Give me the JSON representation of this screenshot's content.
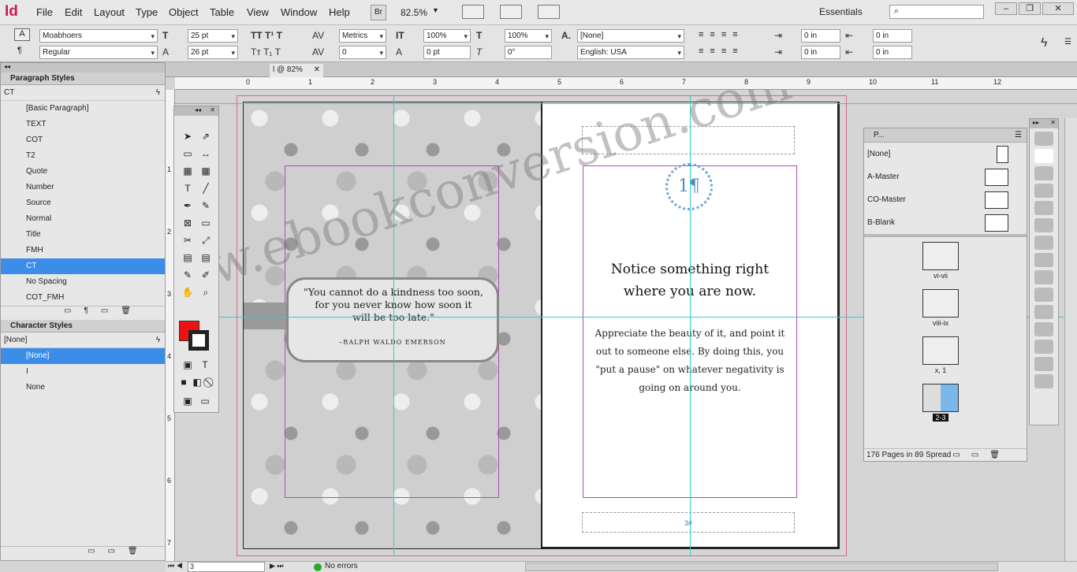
{
  "app": {
    "logo": "Id",
    "menu": [
      "File",
      "Edit",
      "Layout",
      "Type",
      "Object",
      "Table",
      "View",
      "Window",
      "Help"
    ],
    "bridge_btn": "Br",
    "zoom": "82.5%",
    "workspace": "Essentials",
    "search_placeholder": ""
  },
  "control": {
    "font_family": "Moabhoers",
    "font_style": "Regular",
    "font_size": "25 pt",
    "leading": "26 pt",
    "kerning": "Metrics",
    "tracking": "0",
    "vscale": "100%",
    "hscale": "100%",
    "baseline": "0 pt",
    "skew": "0°",
    "char_style": "[None]",
    "language": "English: USA",
    "indent_left": "0 in",
    "indent_right": "0 in",
    "space_before": "0 in",
    "space_after": "0 in"
  },
  "doc_tab": {
    "label": "l @ 82%"
  },
  "ruler": {
    "top": [
      "0",
      "1",
      "2",
      "3",
      "4",
      "5",
      "6",
      "7",
      "8",
      "9",
      "10",
      "11",
      "12"
    ],
    "left": [
      "1",
      "2",
      "3",
      "4",
      "5",
      "6",
      "7"
    ]
  },
  "paragraph_styles": {
    "title": "Paragraph Styles",
    "current": "CT",
    "items": [
      {
        "label": "[Basic Paragraph]"
      },
      {
        "label": "TEXT"
      },
      {
        "label": "COT"
      },
      {
        "label": "T2"
      },
      {
        "label": "Quote"
      },
      {
        "label": "Number"
      },
      {
        "label": "Source"
      },
      {
        "label": "Normal",
        "saved": true
      },
      {
        "label": "Title",
        "saved": true
      },
      {
        "label": "FMH"
      },
      {
        "label": "CT",
        "selected": true
      },
      {
        "label": "No Spacing",
        "saved": true
      },
      {
        "label": "COT_FMH"
      }
    ]
  },
  "character_styles": {
    "title": "Character Styles",
    "current": "[None]",
    "items": [
      {
        "label": "[None]",
        "selected": true
      },
      {
        "label": "I"
      },
      {
        "label": "None",
        "saved": true
      }
    ]
  },
  "spread": {
    "quote_lines": [
      "\"You cannot do a kindness too soon,",
      "for you never know how soon it",
      "will be too late.\""
    ],
    "quote_author": "–RALPH WALDO EMERSON",
    "right_number": "1¶",
    "heading_lines": [
      "Notice something right",
      "where you are now."
    ],
    "body_lines": [
      "Appreciate the beauty of it, and point it",
      "out to someone else. By doing this, you",
      "\"put a pause\" on whatever negativity is",
      "going on around you."
    ],
    "folio": "3#",
    "watermark": "www.ebookconversion.com"
  },
  "pages_panel": {
    "title": "P...",
    "masters": [
      "[None]",
      "A-Master",
      "CO-Master",
      "B-Blank"
    ],
    "spreads": [
      {
        "label": "vi-vii"
      },
      {
        "label": "viii-ix"
      },
      {
        "label": "x, 1"
      },
      {
        "label": "2-3",
        "current": true
      }
    ],
    "footer": "176 Pages in 89 Spread"
  },
  "status": {
    "page": "3",
    "preflight": "No errors"
  },
  "colors": {
    "accent": "#3b8de8",
    "fill": "#ee1111",
    "guide": "#33cccc",
    "margin": "#cc66cc"
  }
}
